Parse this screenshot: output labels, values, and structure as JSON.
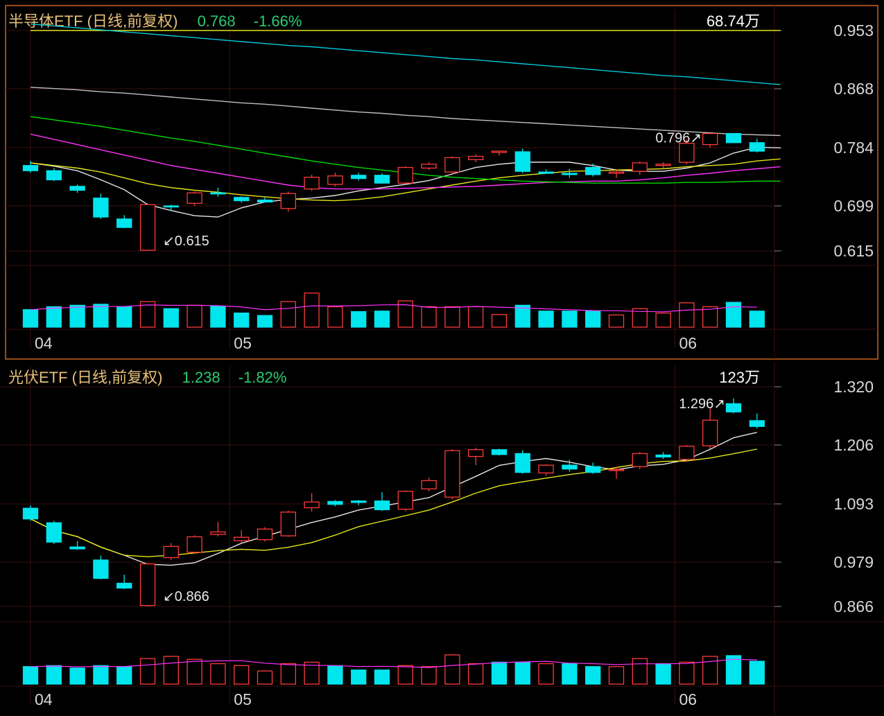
{
  "colors": {
    "up": "#ff3b3b",
    "down": "#00e5ee",
    "ma5": "#e6e6e6",
    "ma10": "#e6e619",
    "ma20": "#ff33ff",
    "ma30": "#00dd00",
    "ma60": "#c0c0c0",
    "ma120": "#00c8dc",
    "title": "#e6c07b",
    "quote": "#2ecc71",
    "frame": "#c8641e",
    "grid": "#3a1010"
  },
  "chart_data": [
    {
      "type": "candlestick",
      "name": "半导体ETF",
      "title": "半导体ETF (日线,前复权)",
      "price": "0.768",
      "change": "-1.66%",
      "volume_label": "68.74万",
      "y_ticks": [
        "0.953",
        "0.868",
        "0.784",
        "0.699",
        "0.615"
      ],
      "ylim": [
        0.615,
        0.953
      ],
      "x_tick_labels": [
        {
          "label": "04",
          "index": 0
        },
        {
          "label": "05",
          "index": 8.5
        },
        {
          "label": "06",
          "index": 27.5
        }
      ],
      "annotations": [
        {
          "text": "↙0.615",
          "index": 5,
          "value": 0.615,
          "kind": "low"
        },
        {
          "text": "0.796↗",
          "index": 29,
          "value": 0.796,
          "kind": "high"
        }
      ],
      "candles": [
        {
          "o": 0.746,
          "h": 0.753,
          "l": 0.735,
          "c": 0.738
        },
        {
          "o": 0.738,
          "h": 0.742,
          "l": 0.722,
          "c": 0.724
        },
        {
          "o": 0.714,
          "h": 0.717,
          "l": 0.704,
          "c": 0.708
        },
        {
          "o": 0.696,
          "h": 0.703,
          "l": 0.664,
          "c": 0.667
        },
        {
          "o": 0.664,
          "h": 0.67,
          "l": 0.65,
          "c": 0.651
        },
        {
          "o": 0.616,
          "h": 0.688,
          "l": 0.615,
          "c": 0.686
        },
        {
          "o": 0.684,
          "h": 0.686,
          "l": 0.676,
          "c": 0.683
        },
        {
          "o": 0.688,
          "h": 0.706,
          "l": 0.684,
          "c": 0.704
        },
        {
          "o": 0.704,
          "h": 0.712,
          "l": 0.698,
          "c": 0.703
        },
        {
          "o": 0.697,
          "h": 0.699,
          "l": 0.689,
          "c": 0.692
        },
        {
          "o": 0.693,
          "h": 0.697,
          "l": 0.689,
          "c": 0.69
        },
        {
          "o": 0.68,
          "h": 0.706,
          "l": 0.675,
          "c": 0.703
        },
        {
          "o": 0.71,
          "h": 0.732,
          "l": 0.707,
          "c": 0.728
        },
        {
          "o": 0.717,
          "h": 0.735,
          "l": 0.714,
          "c": 0.73
        },
        {
          "o": 0.731,
          "h": 0.735,
          "l": 0.723,
          "c": 0.726
        },
        {
          "o": 0.731,
          "h": 0.734,
          "l": 0.718,
          "c": 0.719
        },
        {
          "o": 0.719,
          "h": 0.745,
          "l": 0.717,
          "c": 0.743
        },
        {
          "o": 0.742,
          "h": 0.751,
          "l": 0.739,
          "c": 0.748
        },
        {
          "o": 0.736,
          "h": 0.76,
          "l": 0.733,
          "c": 0.758
        },
        {
          "o": 0.755,
          "h": 0.763,
          "l": 0.751,
          "c": 0.76
        },
        {
          "o": 0.766,
          "h": 0.769,
          "l": 0.761,
          "c": 0.768
        },
        {
          "o": 0.767,
          "h": 0.772,
          "l": 0.734,
          "c": 0.737
        },
        {
          "o": 0.736,
          "h": 0.74,
          "l": 0.733,
          "c": 0.734
        },
        {
          "o": 0.734,
          "h": 0.741,
          "l": 0.727,
          "c": 0.732
        },
        {
          "o": 0.743,
          "h": 0.749,
          "l": 0.729,
          "c": 0.732
        },
        {
          "o": 0.734,
          "h": 0.739,
          "l": 0.727,
          "c": 0.736
        },
        {
          "o": 0.737,
          "h": 0.752,
          "l": 0.732,
          "c": 0.75
        },
        {
          "o": 0.746,
          "h": 0.751,
          "l": 0.742,
          "c": 0.748
        },
        {
          "o": 0.751,
          "h": 0.786,
          "l": 0.748,
          "c": 0.78
        },
        {
          "o": 0.778,
          "h": 0.796,
          "l": 0.773,
          "c": 0.795
        },
        {
          "o": 0.795,
          "h": 0.796,
          "l": 0.78,
          "c": 0.781
        },
        {
          "o": 0.781,
          "h": 0.787,
          "l": 0.766,
          "c": 0.768
        }
      ],
      "volumes": [
        0.72,
        0.84,
        0.9,
        0.94,
        0.84,
        1.05,
        0.76,
        0.9,
        0.86,
        0.58,
        0.48,
        1.05,
        1.4,
        0.84,
        0.64,
        0.66,
        1.08,
        0.84,
        0.84,
        0.84,
        0.52,
        0.9,
        0.66,
        0.66,
        0.66,
        0.5,
        0.76,
        0.58,
        1.0,
        0.84,
        1.02,
        0.66
      ],
      "moving_averages": [
        {
          "key": "ma5",
          "values": [
            0.75,
            0.745,
            0.738,
            0.724,
            0.709,
            0.686,
            0.677,
            0.669,
            0.667,
            0.681,
            0.69,
            0.694,
            0.696,
            0.7,
            0.707,
            0.712,
            0.717,
            0.723,
            0.733,
            0.743,
            0.748,
            0.751,
            0.751,
            0.751,
            0.746,
            0.739,
            0.737,
            0.737,
            0.742,
            0.75,
            0.765,
            0.774,
            0.773
          ]
        },
        {
          "key": "ma10",
          "values": [
            0.75,
            0.746,
            0.742,
            0.736,
            0.727,
            0.718,
            0.712,
            0.708,
            0.705,
            0.701,
            0.698,
            0.695,
            0.693,
            0.692,
            0.694,
            0.698,
            0.704,
            0.71,
            0.716,
            0.722,
            0.727,
            0.731,
            0.734,
            0.737,
            0.738,
            0.739,
            0.74,
            0.741,
            0.744,
            0.746,
            0.748,
            0.753,
            0.756
          ]
        },
        {
          "key": "ma20",
          "values": [
            0.794,
            0.786,
            0.778,
            0.77,
            0.762,
            0.754,
            0.746,
            0.74,
            0.734,
            0.728,
            0.722,
            0.716,
            0.712,
            0.71,
            0.71,
            0.71,
            0.711,
            0.712,
            0.713,
            0.714,
            0.716,
            0.718,
            0.72,
            0.721,
            0.722,
            0.722,
            0.724,
            0.727,
            0.731,
            0.734,
            0.738,
            0.741,
            0.744
          ]
        },
        {
          "key": "ma30",
          "values": [
            0.821,
            0.816,
            0.811,
            0.806,
            0.8,
            0.794,
            0.788,
            0.783,
            0.777,
            0.771,
            0.765,
            0.759,
            0.753,
            0.748,
            0.743,
            0.739,
            0.735,
            0.731,
            0.728,
            0.726,
            0.724,
            0.722,
            0.721,
            0.72,
            0.719,
            0.719,
            0.719,
            0.719,
            0.72,
            0.72,
            0.721,
            0.722,
            0.722
          ]
        },
        {
          "key": "ma60",
          "values": [
            0.866,
            0.864,
            0.862,
            0.859,
            0.857,
            0.854,
            0.851,
            0.848,
            0.845,
            0.842,
            0.84,
            0.837,
            0.834,
            0.831,
            0.828,
            0.826,
            0.823,
            0.821,
            0.818,
            0.816,
            0.814,
            0.812,
            0.81,
            0.808,
            0.806,
            0.804,
            0.802,
            0.8,
            0.798,
            0.796,
            0.794,
            0.793,
            0.792
          ]
        },
        {
          "key": "ma10",
          "values": [
            0.953,
            0.953,
            0.953,
            0.953,
            0.953,
            0.953,
            0.953,
            0.953,
            0.953,
            0.953,
            0.953,
            0.953,
            0.953,
            0.953,
            0.953,
            0.953,
            0.953,
            0.953,
            0.953,
            0.953,
            0.953,
            0.953,
            0.953,
            0.953,
            0.953,
            0.953,
            0.953,
            0.953,
            0.953,
            0.953,
            0.953,
            0.953,
            0.953
          ]
        },
        {
          "key": "ma120",
          "values": [
            0.963,
            0.96,
            0.957,
            0.954,
            0.951,
            0.948,
            0.945,
            0.942,
            0.939,
            0.936,
            0.933,
            0.93,
            0.928,
            0.925,
            0.922,
            0.919,
            0.916,
            0.913,
            0.91,
            0.908,
            0.905,
            0.902,
            0.899,
            0.896,
            0.893,
            0.89,
            0.887,
            0.884,
            0.882,
            0.879,
            0.876,
            0.873,
            0.87
          ]
        }
      ]
    },
    {
      "type": "candlestick",
      "name": "光伏ETF",
      "title": "光伏ETF (日线,前复权)",
      "price": "1.238",
      "change": "-1.82%",
      "volume_label": "123万",
      "y_ticks": [
        "1.320",
        "1.206",
        "1.093",
        "0.979",
        "0.866"
      ],
      "ylim": [
        0.866,
        1.32
      ],
      "x_tick_labels": [
        {
          "label": "04",
          "index": 0
        },
        {
          "label": "05",
          "index": 8.5
        },
        {
          "label": "06",
          "index": 27.5
        }
      ],
      "annotations": [
        {
          "text": "↙0.866",
          "index": 5,
          "value": 0.866,
          "kind": "low"
        },
        {
          "text": "1.296↗",
          "index": 30,
          "value": 1.296,
          "kind": "high"
        }
      ],
      "candles": [
        {
          "o": 1.069,
          "h": 1.075,
          "l": 1.043,
          "c": 1.047
        },
        {
          "o": 1.039,
          "h": 1.043,
          "l": 0.995,
          "c": 0.999
        },
        {
          "o": 0.989,
          "h": 1.001,
          "l": 0.983,
          "c": 0.985
        },
        {
          "o": 0.962,
          "h": 0.971,
          "l": 0.922,
          "c": 0.924
        },
        {
          "o": 0.914,
          "h": 0.932,
          "l": 0.902,
          "c": 0.904
        },
        {
          "o": 0.868,
          "h": 0.956,
          "l": 0.866,
          "c": 0.954
        },
        {
          "o": 0.967,
          "h": 0.997,
          "l": 0.962,
          "c": 0.99
        },
        {
          "o": 0.978,
          "h": 1.013,
          "l": 0.976,
          "c": 1.01
        },
        {
          "o": 1.015,
          "h": 1.041,
          "l": 1.011,
          "c": 1.02
        },
        {
          "o": 1.002,
          "h": 1.024,
          "l": 0.997,
          "c": 1.009
        },
        {
          "o": 1.004,
          "h": 1.03,
          "l": 1.0,
          "c": 1.026
        },
        {
          "o": 1.012,
          "h": 1.064,
          "l": 1.01,
          "c": 1.061
        },
        {
          "o": 1.07,
          "h": 1.1,
          "l": 1.062,
          "c": 1.082
        },
        {
          "o": 1.083,
          "h": 1.086,
          "l": 1.073,
          "c": 1.077
        },
        {
          "o": 1.084,
          "h": 1.086,
          "l": 1.075,
          "c": 1.081
        },
        {
          "o": 1.084,
          "h": 1.102,
          "l": 1.063,
          "c": 1.066
        },
        {
          "o": 1.067,
          "h": 1.106,
          "l": 1.063,
          "c": 1.104
        },
        {
          "o": 1.109,
          "h": 1.132,
          "l": 1.104,
          "c": 1.126
        },
        {
          "o": 1.092,
          "h": 1.191,
          "l": 1.087,
          "c": 1.188
        },
        {
          "o": 1.176,
          "h": 1.194,
          "l": 1.158,
          "c": 1.19
        },
        {
          "o": 1.19,
          "h": 1.192,
          "l": 1.178,
          "c": 1.18
        },
        {
          "o": 1.182,
          "h": 1.189,
          "l": 1.14,
          "c": 1.143
        },
        {
          "o": 1.142,
          "h": 1.16,
          "l": 1.136,
          "c": 1.158
        },
        {
          "o": 1.158,
          "h": 1.169,
          "l": 1.145,
          "c": 1.15
        },
        {
          "o": 1.155,
          "h": 1.163,
          "l": 1.14,
          "c": 1.143
        },
        {
          "o": 1.148,
          "h": 1.155,
          "l": 1.13,
          "c": 1.149
        },
        {
          "o": 1.155,
          "h": 1.185,
          "l": 1.15,
          "c": 1.182
        },
        {
          "o": 1.179,
          "h": 1.185,
          "l": 1.171,
          "c": 1.175
        },
        {
          "o": 1.17,
          "h": 1.2,
          "l": 1.166,
          "c": 1.197
        },
        {
          "o": 1.198,
          "h": 1.275,
          "l": 1.192,
          "c": 1.251
        },
        {
          "o": 1.285,
          "h": 1.296,
          "l": 1.265,
          "c": 1.268
        },
        {
          "o": 1.25,
          "h": 1.265,
          "l": 1.234,
          "c": 1.238
        }
      ],
      "volumes": [
        0.72,
        0.76,
        0.66,
        0.76,
        0.72,
        1.05,
        1.14,
        1.02,
        0.84,
        0.76,
        0.54,
        0.84,
        0.9,
        0.76,
        0.58,
        0.58,
        0.76,
        0.72,
        1.2,
        0.84,
        0.9,
        0.9,
        0.84,
        0.84,
        0.72,
        0.72,
        1.05,
        0.84,
        0.9,
        1.14,
        1.17,
        0.94
      ]
    }
  ]
}
